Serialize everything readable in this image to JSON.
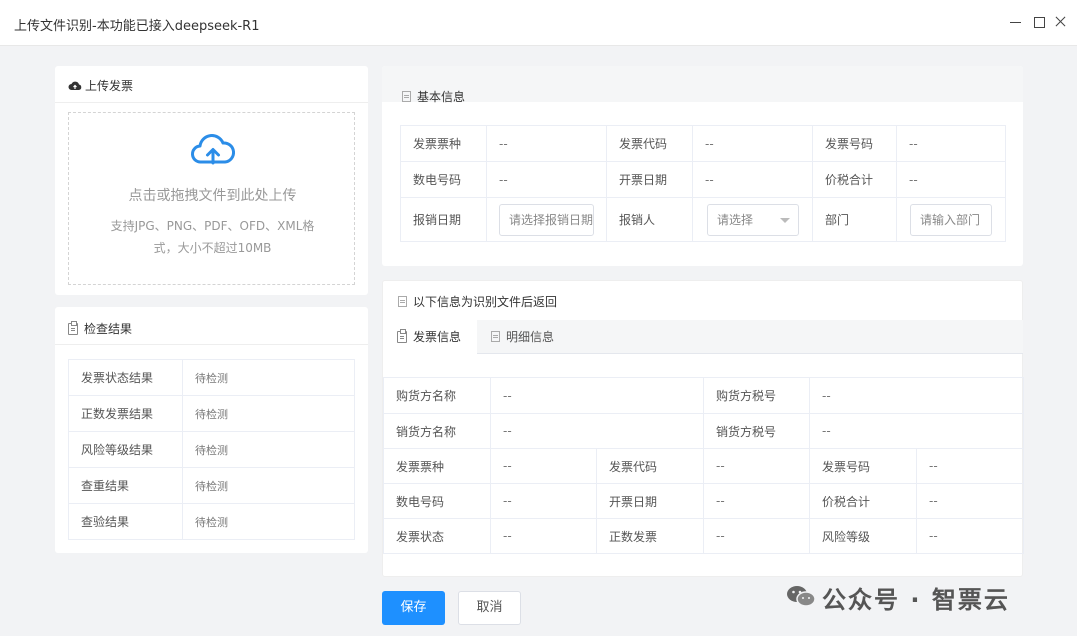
{
  "window": {
    "title": "上传文件识别-本功能已接入deepseek-R1"
  },
  "upload_panel": {
    "title": "上传发票",
    "main_text": "点击或拖拽文件到此处上传",
    "hint_line1": "支持JPG、PNG、PDF、OFD、XML格",
    "hint_line2": "式，大小不超过10MB"
  },
  "check_panel": {
    "title": "检查结果",
    "rows": [
      {
        "label": "发票状态结果",
        "value": "待检测"
      },
      {
        "label": "正数发票结果",
        "value": "待检测"
      },
      {
        "label": "风险等级结果",
        "value": "待检测"
      },
      {
        "label": "查重结果",
        "value": "待检测"
      },
      {
        "label": "查验结果",
        "value": "待检测"
      }
    ]
  },
  "basic_info": {
    "title": "基本信息",
    "row1": [
      {
        "label": "发票票种",
        "value": "--"
      },
      {
        "label": "发票代码",
        "value": "--"
      },
      {
        "label": "发票号码",
        "value": "--"
      }
    ],
    "row2": [
      {
        "label": "数电号码",
        "value": "--"
      },
      {
        "label": "开票日期",
        "value": "--"
      },
      {
        "label": "价税合计",
        "value": "--"
      }
    ],
    "row3": {
      "date_label": "报销日期",
      "date_placeholder": "请选择报销日期",
      "person_label": "报销人",
      "person_placeholder": "请选择",
      "dept_label": "部门",
      "dept_placeholder": "请输入部门"
    }
  },
  "result_panel": {
    "title": "以下信息为识别文件后返回",
    "tabs": [
      "发票信息",
      "明细信息"
    ],
    "buyer_rows": [
      {
        "label1": "购货方名称",
        "value1": "--",
        "label2": "购货方税号",
        "value2": "--"
      },
      {
        "label1": "销货方名称",
        "value1": "--",
        "label2": "销货方税号",
        "value2": "--"
      }
    ],
    "info_rows": [
      [
        {
          "label": "发票票种",
          "value": "--"
        },
        {
          "label": "发票代码",
          "value": "--"
        },
        {
          "label": "发票号码",
          "value": "--"
        }
      ],
      [
        {
          "label": "数电号码",
          "value": "--"
        },
        {
          "label": "开票日期",
          "value": "--"
        },
        {
          "label": "价税合计",
          "value": "--"
        }
      ],
      [
        {
          "label": "发票状态",
          "value": "--"
        },
        {
          "label": "正数发票",
          "value": "--"
        },
        {
          "label": "风险等级",
          "value": "--"
        }
      ]
    ]
  },
  "actions": {
    "save": "保存",
    "cancel": "取消"
  },
  "watermark": {
    "text": "公众号 · 智票云"
  },
  "colors": {
    "primary": "#1e90ff",
    "cloud_icon": "#2b8de8"
  }
}
